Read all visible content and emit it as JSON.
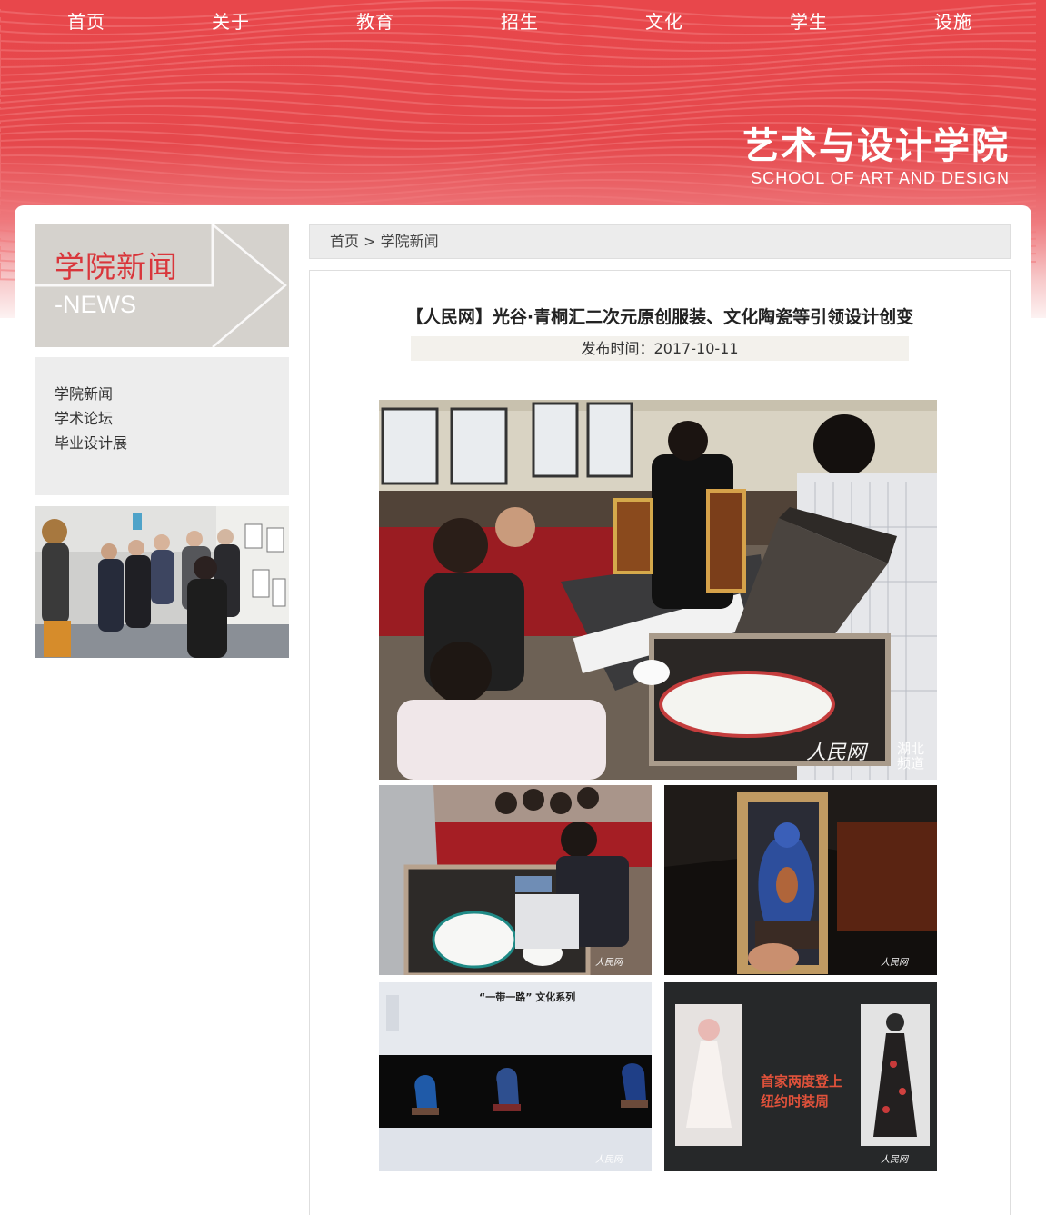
{
  "nav": {
    "items": [
      "首页",
      "关于",
      "教育",
      "招生",
      "文化",
      "学生",
      "设施"
    ]
  },
  "logo": {
    "cn": "艺术与设计学院",
    "en": "SCHOOL OF ART AND DESIGN"
  },
  "sidebar": {
    "banner_title": "学院新闻",
    "banner_sub": "-NEWS",
    "menu": [
      "学院新闻",
      "学术论坛",
      "毕业设计展"
    ]
  },
  "breadcrumb": {
    "home": "首页",
    "sep": ">",
    "current": "学院新闻"
  },
  "article": {
    "title": "【人民网】光谷·青桐汇二次元原创服装、文化陶瓷等引领设计创变",
    "date_label": "发布时间：",
    "date": "2017-10-11",
    "watermark_brand": "人民网",
    "watermark_region": "湖北频道",
    "photo4_caption": "“一带一路” 文化系列",
    "photo5_text": "首家两度登上纽约时装周"
  },
  "colors": {
    "header_red": "#e5484c",
    "accent_red": "#d9363b",
    "sidebar_gray": "#d5d2cd",
    "menu_gray": "#ededed"
  }
}
